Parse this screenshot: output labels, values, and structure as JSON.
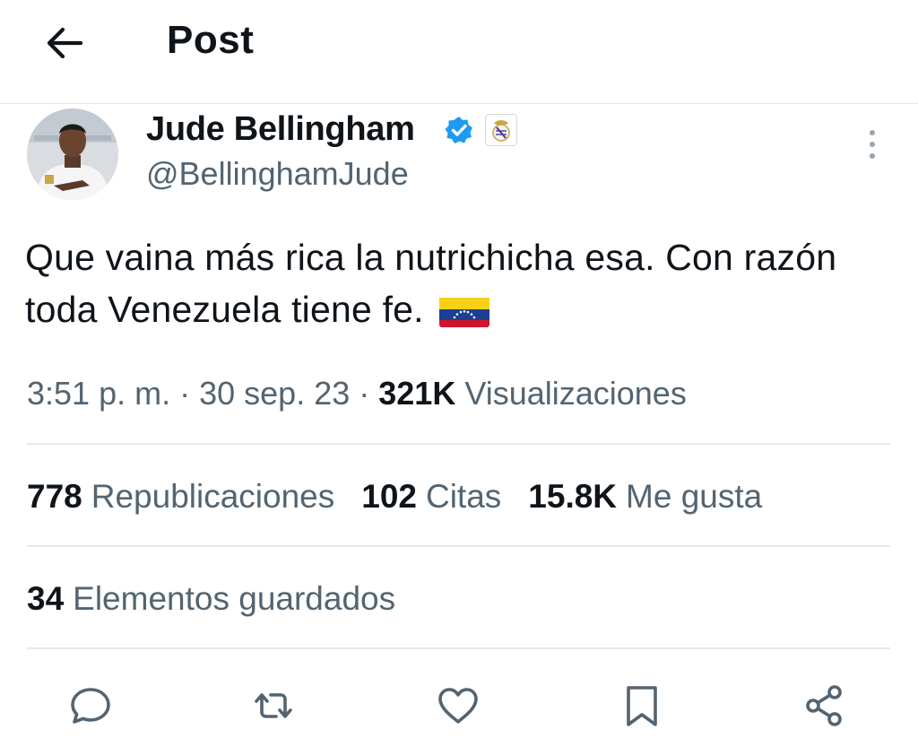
{
  "header": {
    "title": "Post",
    "back_icon": "arrow-left-icon"
  },
  "author": {
    "name": "Jude Bellingham",
    "handle": "@BellinghamJude",
    "verified_color": "#1d9bf0",
    "affiliation_icon": "real-madrid-crest-icon"
  },
  "tweet": {
    "text": "Que vaina más rica la nutrichicha esa. Con razón toda Venezuela tiene fe.",
    "emoji": "venezuela-flag-icon"
  },
  "meta": {
    "time": "3:51 p. m.",
    "date": "30 sep. 23",
    "views_count": "321K",
    "views_label": "Visualizaciones"
  },
  "stats": {
    "reposts_count": "778",
    "reposts_label": "Republicaciones",
    "quotes_count": "102",
    "quotes_label": "Citas",
    "likes_count": "15.8K",
    "likes_label": "Me gusta",
    "bookmarks_count": "34",
    "bookmarks_label": "Elementos guardados"
  },
  "actions": [
    "reply-icon",
    "repost-icon",
    "like-icon",
    "bookmark-icon",
    "share-icon"
  ]
}
